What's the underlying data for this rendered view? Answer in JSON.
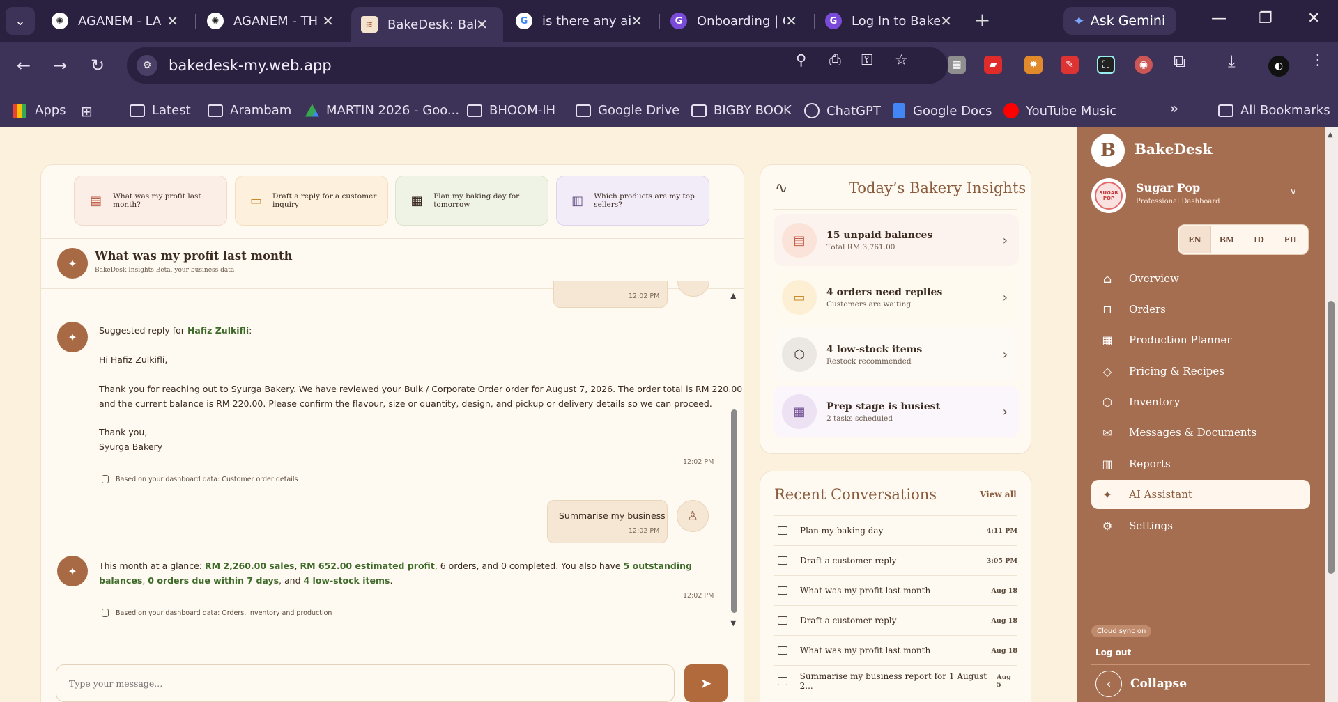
{
  "browser": {
    "tabs": [
      {
        "title": "AGANEM - LA",
        "icon": "chatgpt-icon"
      },
      {
        "title": "AGANEM - TH",
        "icon": "chatgpt-icon"
      },
      {
        "title": "BakeDesk: Bak",
        "icon": "bakedesk-icon",
        "active": true
      },
      {
        "title": "is there any ai",
        "icon": "google-icon"
      },
      {
        "title": "Onboarding | C",
        "icon": "g-app-icon"
      },
      {
        "title": "Log In to Bake",
        "icon": "g-app-icon"
      }
    ],
    "ask_gemini": "Ask Gemini",
    "url": "bakedesk-my.web.app",
    "bookmarks": [
      "Apps",
      "Latest",
      "Arambam",
      "MARTIN 2026 - Goo...",
      "BHOOM-IH",
      "Google Drive",
      "BIGBY BOOK",
      "ChatGPT",
      "Google Docs",
      "YouTube Music"
    ],
    "more_bookmarks": "»",
    "all_bookmarks": "All Bookmarks"
  },
  "chat": {
    "suggestions": [
      {
        "label": "What was my profit last month?",
        "icon": "document-icon"
      },
      {
        "label": "Draft a reply for a customer inquiry",
        "icon": "message-icon"
      },
      {
        "label": "Plan my baking day for tomorrow",
        "icon": "calendar-icon"
      },
      {
        "label": "Which products are my top sellers?",
        "icon": "bar-chart-icon"
      }
    ],
    "header_title": "What was my profit last month",
    "header_subtitle": "BakeDesk Insights Beta, your business data",
    "top_timestamp": "12:02 PM",
    "reply_intro": "Suggested reply for ",
    "reply_name": "Hafiz Zulkifli",
    "reply_intro_end": ":",
    "reply_greeting": "Hi Hafiz Zulkifli,",
    "reply_body_1": "Thank you for reaching out to Syurga Bakery. We have reviewed your Bulk / Corporate Order order for August 7, 2026. The order total is RM 220.00",
    "reply_body_2": "and the current balance is RM 220.00. Please confirm the flavour, size or quantity, design, and pickup or delivery details so we can proceed.",
    "reply_signoff": "Thank you,",
    "reply_sender": "Syurga Bakery",
    "reply_timestamp": "12:02 PM",
    "reply_source": "Based on your dashboard data: Customer order details",
    "user_message": "Summarise my business",
    "user_timestamp": "12:02 PM",
    "summary_p1": "This month at a glance: ",
    "summary_sales": "RM 2,260.00 sales",
    "summary_comma1": ", ",
    "summary_profit": "RM 652.00 estimated profit",
    "summary_p2": ", 6 orders, and 0 completed. You also have ",
    "summary_balances": "5 outstanding balances",
    "summary_comma2": ", ",
    "summary_due": "0 orders due within 7 days",
    "summary_p3": ", and ",
    "summary_lowstock": "4 low-stock items",
    "summary_end": ".",
    "summary_timestamp": "12:02 PM",
    "summary_source": "Based on your dashboard data: Orders, inventory and production",
    "input_placeholder": "Type your message..."
  },
  "insights": {
    "title": "Today’s Bakery Insights",
    "items": [
      {
        "title": "15 unpaid balances",
        "sub": "Total RM 3,761.00",
        "color": "#fbe9e2"
      },
      {
        "title": "4 orders need replies",
        "sub": "Customers are waiting",
        "color": "#fdf0d6"
      },
      {
        "title": "4 low-stock items",
        "sub": "Restock recommended",
        "color": "#eeeae4"
      },
      {
        "title": "Prep stage is busiest",
        "sub": "2 tasks scheduled",
        "color": "#efe6f5"
      }
    ]
  },
  "recent": {
    "title": "Recent Conversations",
    "view_all": "View all",
    "items": [
      {
        "title": "Plan my baking day",
        "time": "4:11 PM"
      },
      {
        "title": "Draft a customer reply",
        "time": "3:05 PM"
      },
      {
        "title": "What was my profit last month",
        "time": "Aug 18"
      },
      {
        "title": "Draft a customer reply",
        "time": "Aug 18"
      },
      {
        "title": "What was my profit last month",
        "time": "Aug 18"
      },
      {
        "title": "Summarise my business report for 1 August 2...",
        "time": "Aug 5"
      }
    ]
  },
  "sidebar": {
    "logo_letter": "B",
    "brand": "BakeDesk",
    "shop_name": "Sugar Pop",
    "shop_role": "Professional Dashboard",
    "shop_logo_text": "SUGAR POP",
    "dropdown": "v",
    "languages": [
      "EN",
      "BM",
      "ID",
      "FIL"
    ],
    "nav": [
      {
        "label": "Overview",
        "icon": "home-icon"
      },
      {
        "label": "Orders",
        "icon": "bag-icon"
      },
      {
        "label": "Production Planner",
        "icon": "calendar-icon"
      },
      {
        "label": "Pricing & Recipes",
        "icon": "tag-icon"
      },
      {
        "label": "Inventory",
        "icon": "box-icon"
      },
      {
        "label": "Messages & Documents",
        "icon": "mail-icon"
      },
      {
        "label": "Reports",
        "icon": "bar-chart-icon"
      },
      {
        "label": "AI Assistant",
        "icon": "sparkle-icon",
        "active": true
      },
      {
        "label": "Settings",
        "icon": "gear-icon"
      }
    ],
    "cloud_sync": "Cloud sync on",
    "logout": "Log out",
    "collapse": "Collapse"
  }
}
